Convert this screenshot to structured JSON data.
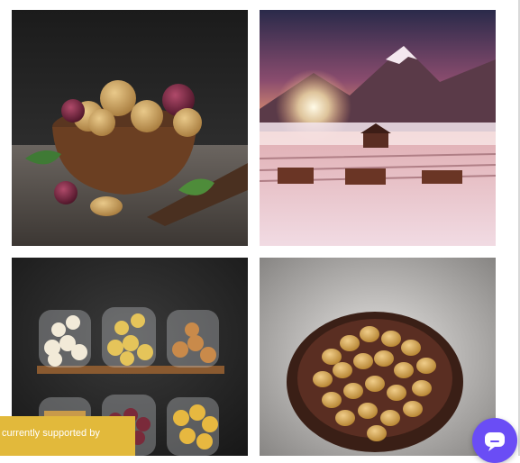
{
  "gallery": {
    "images": [
      {
        "icon": "potatoes-in-bowl-image"
      },
      {
        "icon": "sunset-mountain-farm-image"
      },
      {
        "icon": "potatoes-in-jars-image"
      },
      {
        "icon": "potatoes-in-dish-image"
      }
    ]
  },
  "support_banner": {
    "text": "currently supported by"
  },
  "chat": {
    "icon": "chat-bubble-icon"
  },
  "colors": {
    "banner": "#e2b93b",
    "chat_button": "#6a4df5"
  }
}
